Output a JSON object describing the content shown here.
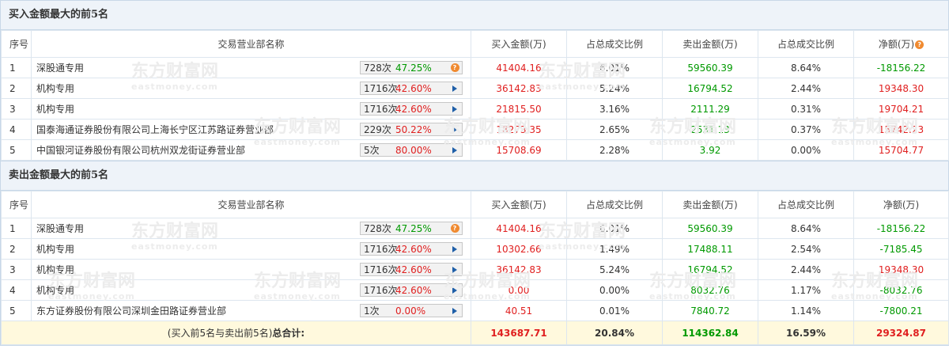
{
  "watermark": {
    "cn": "东方财富网",
    "en": "eastmoney.com"
  },
  "headers": {
    "idx": "序号",
    "name": "交易营业部名称",
    "buy": "买入金额(万)",
    "buy_pct": "占总成交比例",
    "sell": "卖出金额(万)",
    "sell_pct": "占总成交比例",
    "net": "净额(万)"
  },
  "icons": {
    "info": "question-mark-icon",
    "arrow": "play-arrow-icon"
  },
  "buy_section": {
    "title": "买入金额最大的前5名",
    "rows": [
      {
        "idx": "1",
        "name": "深股通专用",
        "count": "728次",
        "pct": "47.25%",
        "icon": "q",
        "buy": "41404.16",
        "buy_pct": "6.01%",
        "sell": "59560.39",
        "sell_pct": "8.64%",
        "net": "-18156.22",
        "net_color": "green"
      },
      {
        "idx": "2",
        "name": "机构专用",
        "count": "1716次",
        "pct": "42.60%",
        "icon": "arrow",
        "buy": "36142.83",
        "buy_pct": "5.24%",
        "sell": "16794.52",
        "sell_pct": "2.44%",
        "net": "19348.30",
        "net_color": "red"
      },
      {
        "idx": "3",
        "name": "机构专用",
        "count": "1716次",
        "pct": "42.60%",
        "icon": "arrow",
        "buy": "21815.50",
        "buy_pct": "3.16%",
        "sell": "2111.29",
        "sell_pct": "0.31%",
        "net": "19704.21",
        "net_color": "red"
      },
      {
        "idx": "4",
        "name": "国泰海通证券股份有限公司上海长宁区江苏路证券营业部",
        "count": "229次",
        "pct": "50.22%",
        "icon": "arrow",
        "buy": "18273.35",
        "buy_pct": "2.65%",
        "sell": "2531.13",
        "sell_pct": "0.37%",
        "net": "15742.23",
        "net_color": "red"
      },
      {
        "idx": "5",
        "name": "中国银河证券股份有限公司杭州双龙街证券营业部",
        "count": "5次",
        "pct": "80.00%",
        "icon": "arrow",
        "buy": "15708.69",
        "buy_pct": "2.28%",
        "sell": "3.92",
        "sell_pct": "0.00%",
        "net": "15704.77",
        "net_color": "red"
      }
    ]
  },
  "sell_section": {
    "title": "卖出金额最大的前5名",
    "rows": [
      {
        "idx": "1",
        "name": "深股通专用",
        "count": "728次",
        "pct": "47.25%",
        "icon": "q",
        "buy": "41404.16",
        "buy_pct": "6.01%",
        "sell": "59560.39",
        "sell_pct": "8.64%",
        "net": "-18156.22",
        "net_color": "green"
      },
      {
        "idx": "2",
        "name": "机构专用",
        "count": "1716次",
        "pct": "42.60%",
        "icon": "arrow",
        "buy": "10302.66",
        "buy_pct": "1.49%",
        "sell": "17488.11",
        "sell_pct": "2.54%",
        "net": "-7185.45",
        "net_color": "green"
      },
      {
        "idx": "3",
        "name": "机构专用",
        "count": "1716次",
        "pct": "42.60%",
        "icon": "arrow",
        "buy": "36142.83",
        "buy_pct": "5.24%",
        "sell": "16794.52",
        "sell_pct": "2.44%",
        "net": "19348.30",
        "net_color": "red"
      },
      {
        "idx": "4",
        "name": "机构专用",
        "count": "1716次",
        "pct": "42.60%",
        "icon": "arrow",
        "buy": "0.00",
        "buy_pct": "0.00%",
        "sell": "8032.76",
        "sell_pct": "1.17%",
        "net": "-8032.76",
        "net_color": "green"
      },
      {
        "idx": "5",
        "name": "东方证券股份有限公司深圳金田路证券营业部",
        "count": "1次",
        "pct": "0.00%",
        "icon": "arrow",
        "buy": "40.51",
        "buy_pct": "0.01%",
        "sell": "7840.72",
        "sell_pct": "1.14%",
        "net": "-7800.21",
        "net_color": "green"
      }
    ]
  },
  "total": {
    "label_prefix": "(买入前5名与卖出前5名)",
    "label_bold": "总合计:",
    "buy": "143687.71",
    "buy_pct": "20.84%",
    "sell": "114362.84",
    "sell_pct": "16.59%",
    "net": "29324.87"
  },
  "colors": {
    "buy": "#e02020",
    "sell": "#009900",
    "pct_buy": "#e02020",
    "pct_sell": "#009900",
    "section_bg": "#eef3f9",
    "total_bg": "#fff9dd"
  }
}
